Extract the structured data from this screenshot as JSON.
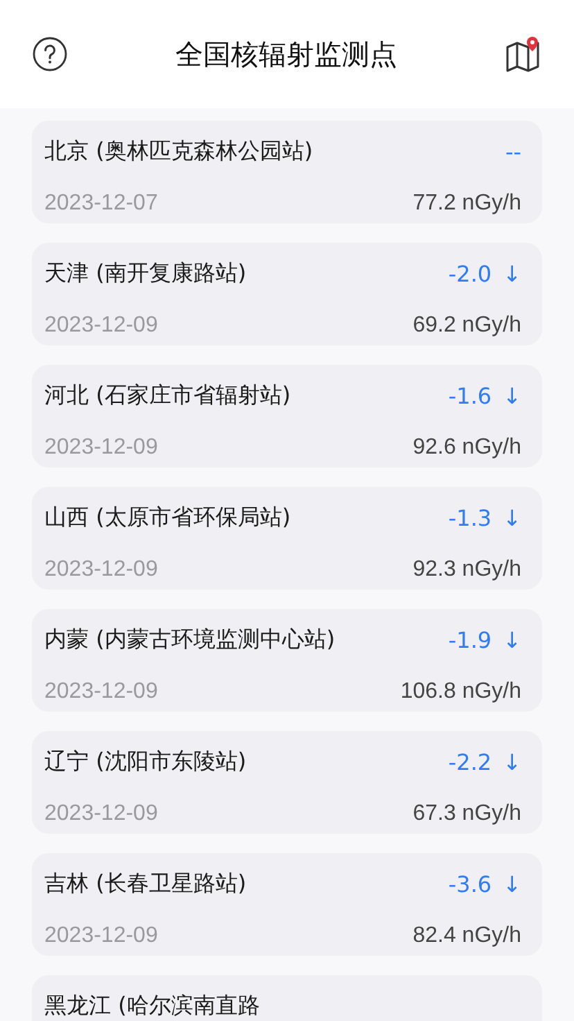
{
  "header": {
    "title": "全国核辐射监测点"
  },
  "stations": [
    {
      "name": "北京 (奥林匹克森林公园站)",
      "change": "--",
      "date": "2023-12-07",
      "reading": "77.2 nGy/h"
    },
    {
      "name": "天津 (南开复康路站)",
      "change": "-2.0",
      "arrow": "↓",
      "date": "2023-12-09",
      "reading": "69.2 nGy/h"
    },
    {
      "name": "河北 (石家庄市省辐射站)",
      "change": "-1.6",
      "arrow": "↓",
      "date": "2023-12-09",
      "reading": "92.6 nGy/h"
    },
    {
      "name": "山西 (太原市省环保局站)",
      "change": "-1.3",
      "arrow": "↓",
      "date": "2023-12-09",
      "reading": "92.3 nGy/h"
    },
    {
      "name": "内蒙 (内蒙古环境监测中心站)",
      "change": "-1.9",
      "arrow": "↓",
      "date": "2023-12-09",
      "reading": "106.8 nGy/h"
    },
    {
      "name": "辽宁 (沈阳市东陵站)",
      "change": "-2.2",
      "arrow": "↓",
      "date": "2023-12-09",
      "reading": "67.3 nGy/h"
    },
    {
      "name": "吉林 (长春卫星路站)",
      "change": "-3.6",
      "arrow": "↓",
      "date": "2023-12-09",
      "reading": "82.4 nGy/h"
    },
    {
      "name": "黑龙江 (哈尔滨南直路"
    }
  ]
}
